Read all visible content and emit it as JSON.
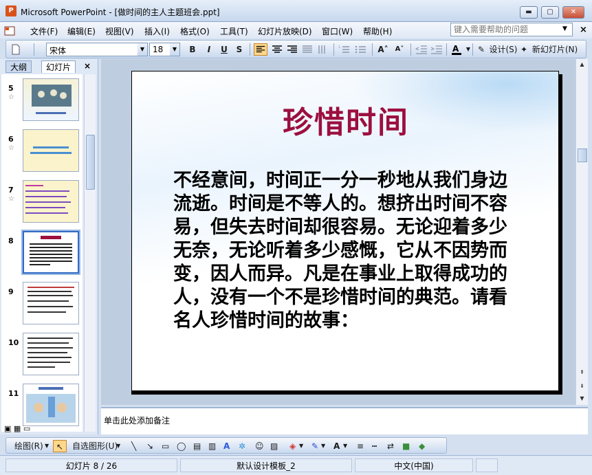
{
  "window": {
    "title": "Microsoft PowerPoint - [做时间的主人主题班会.ppt]",
    "app_icon_label": "P",
    "min_glyph": "▬",
    "max_glyph": "▢",
    "close_glyph": "✕"
  },
  "menubar": {
    "items": [
      "文件(F)",
      "编辑(E)",
      "视图(V)",
      "插入(I)",
      "格式(O)",
      "工具(T)",
      "幻灯片放映(D)",
      "窗口(W)",
      "帮助(H)"
    ],
    "help_placeholder": "键入需要帮助的问题",
    "close_glyph": "×"
  },
  "toolbar": {
    "font_name": "宋体",
    "font_size": "18",
    "bold": "B",
    "italic": "I",
    "underline": "U",
    "shadow": "S",
    "design_label": "设计(S)",
    "new_slide_label": "新幻灯片(N)",
    "accent": "#ffd78a"
  },
  "pane": {
    "tabs": [
      "大纲",
      "幻灯片"
    ],
    "close_glyph": "×",
    "slides": [
      {
        "num": "5",
        "star": "☆"
      },
      {
        "num": "6",
        "star": "☆"
      },
      {
        "num": "7",
        "star": "☆"
      },
      {
        "num": "8",
        "star": ""
      },
      {
        "num": "9",
        "star": ""
      },
      {
        "num": "10",
        "star": ""
      },
      {
        "num": "11",
        "star": ""
      }
    ]
  },
  "slide": {
    "title": "珍惜时间",
    "body": "不经意间，时间正一分一秒地从我们身边流逝。时间是不等人的。想挤出时间不容易，但失去时间却很容易。无论迎着多少无奈，无论听着多少感慨，它从不因势而变，因人而异。凡是在事业上取得成功的人，没有一个不是珍惜时间的典范。请看名人珍惜时间的故事：",
    "title_color": "#9c0f3f"
  },
  "notes": {
    "placeholder": "单击此处添加备注"
  },
  "drawbar": {
    "draw_label": "绘图(R)",
    "autoshapes_label": "自选图形(U)"
  },
  "status": {
    "slide_counter": "幻灯片 8 / 26",
    "template": "默认设计模板_2",
    "language": "中文(中国)"
  }
}
